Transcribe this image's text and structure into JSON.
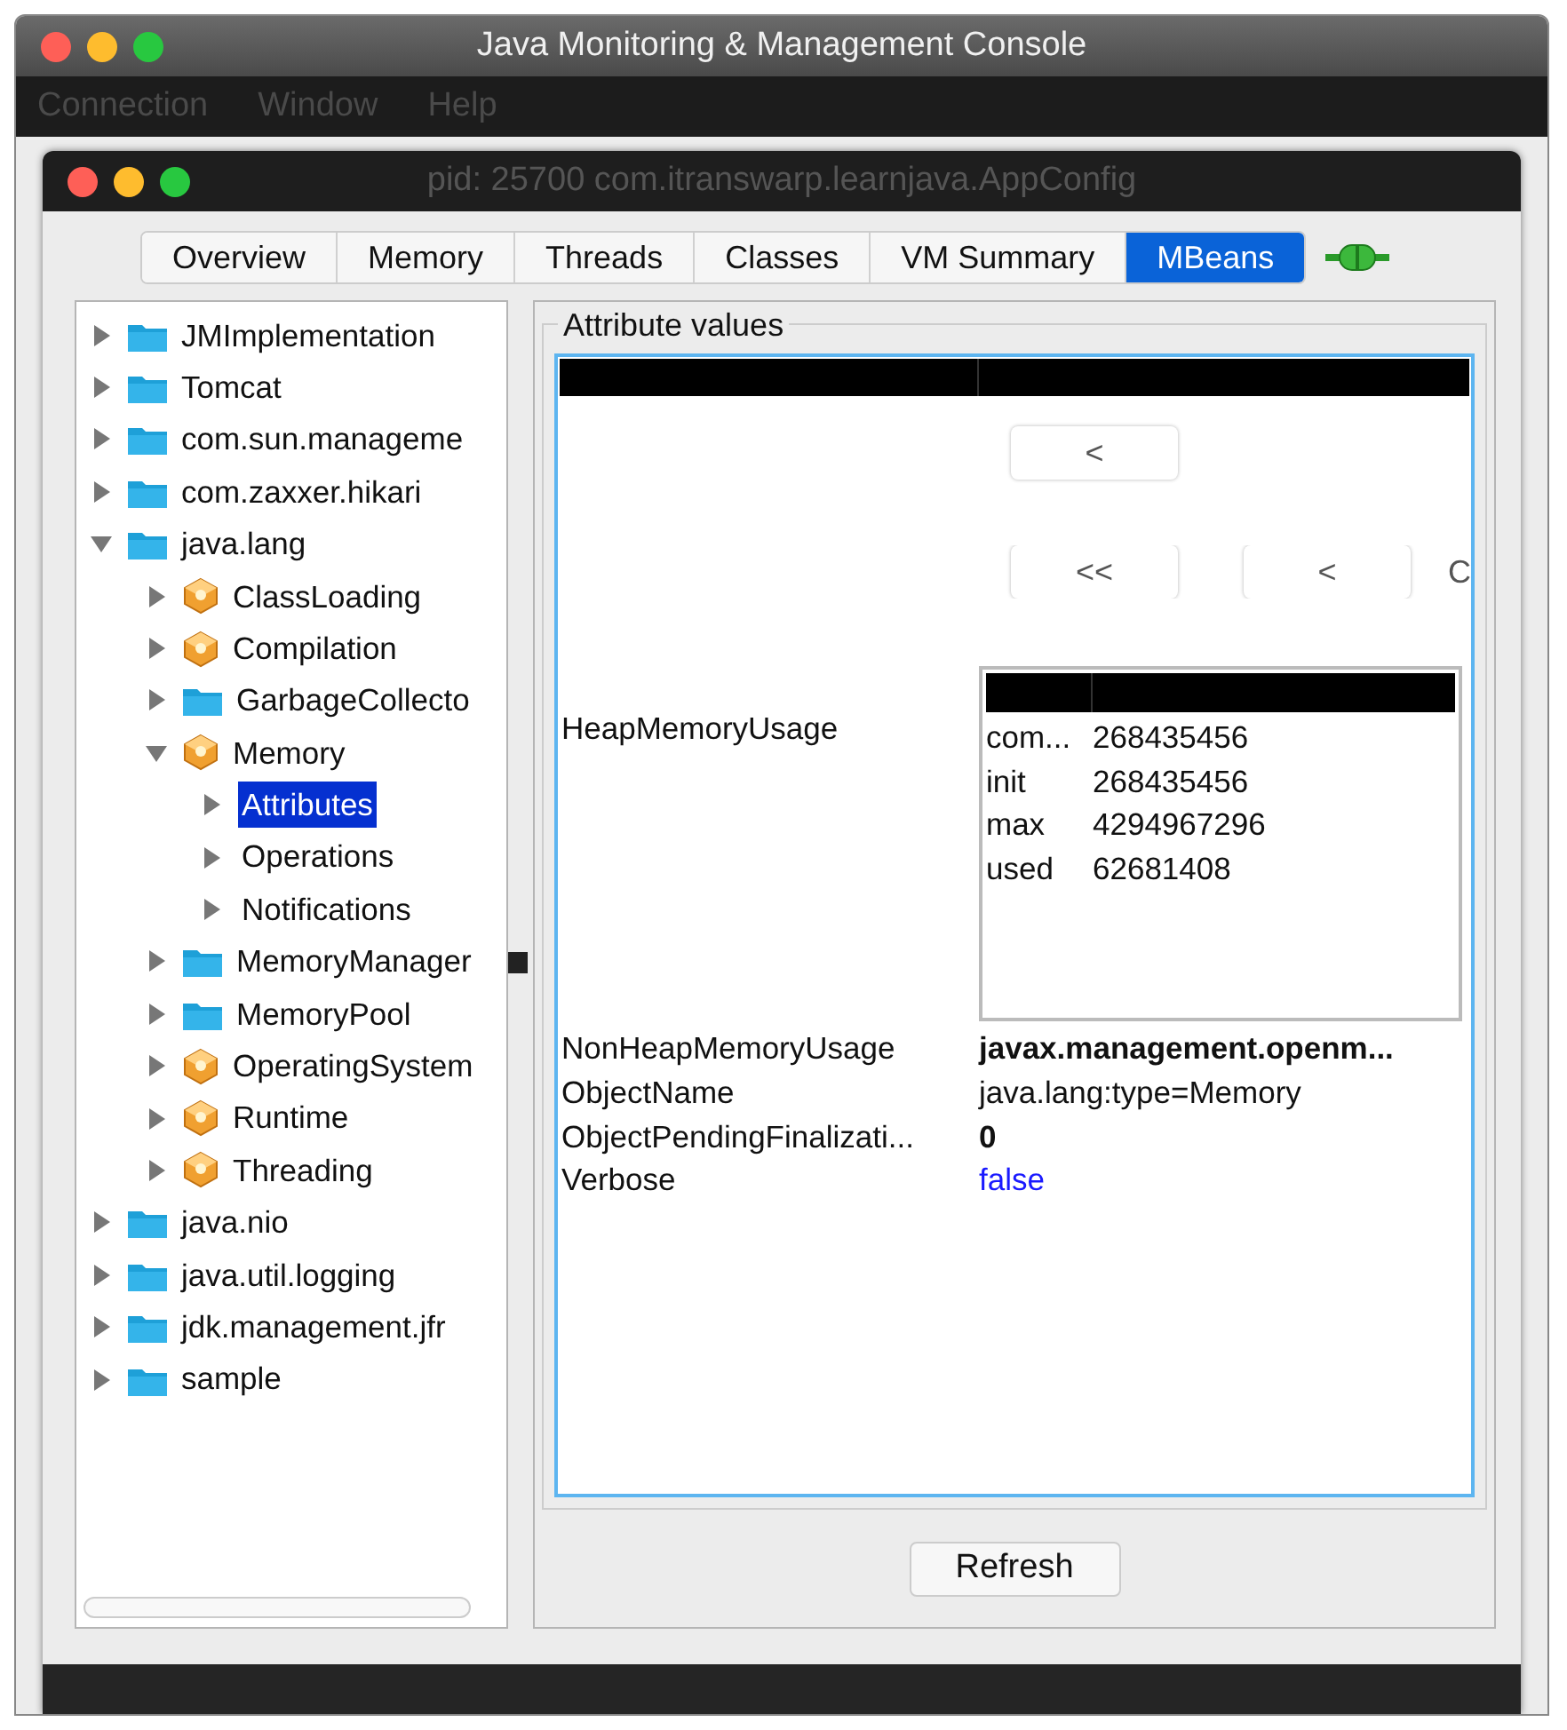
{
  "window": {
    "title": "Java Monitoring & Management Console"
  },
  "menu": [
    "Connection",
    "Window",
    "Help"
  ],
  "inner_window": {
    "title": "pid: 25700 com.itranswarp.learnjava.AppConfig"
  },
  "tabs": [
    {
      "label": "Overview",
      "selected": false
    },
    {
      "label": "Memory",
      "selected": false
    },
    {
      "label": "Threads",
      "selected": false
    },
    {
      "label": "Classes",
      "selected": false
    },
    {
      "label": "VM Summary",
      "selected": false
    },
    {
      "label": "MBeans",
      "selected": true
    }
  ],
  "tree": [
    {
      "label": "JMImplementation",
      "kind": "folder",
      "expanded": false,
      "selected": false
    },
    {
      "label": "Tomcat",
      "kind": "folder",
      "expanded": false,
      "selected": false
    },
    {
      "label": "com.sun.manageme",
      "kind": "folder",
      "expanded": false,
      "selected": false
    },
    {
      "label": "com.zaxxer.hikari",
      "kind": "folder",
      "expanded": false,
      "selected": false
    },
    {
      "label": "java.lang",
      "kind": "folder",
      "expanded": true,
      "selected": false,
      "children": [
        {
          "label": "ClassLoading",
          "kind": "bean",
          "expanded": false,
          "selected": false
        },
        {
          "label": "Compilation",
          "kind": "bean",
          "expanded": false,
          "selected": false
        },
        {
          "label": "GarbageCollecto",
          "kind": "folder",
          "expanded": false,
          "selected": false
        },
        {
          "label": "Memory",
          "kind": "bean",
          "expanded": true,
          "selected": false,
          "children": [
            {
              "label": "Attributes",
              "expanded": false,
              "selected": true
            },
            {
              "label": "Operations",
              "expanded": false,
              "selected": false
            },
            {
              "label": "Notifications",
              "expanded": false,
              "selected": false
            }
          ]
        },
        {
          "label": "MemoryManager",
          "kind": "folder",
          "expanded": false,
          "selected": false
        },
        {
          "label": "MemoryPool",
          "kind": "folder",
          "expanded": false,
          "selected": false
        },
        {
          "label": "OperatingSystem",
          "kind": "bean",
          "expanded": false,
          "selected": false
        },
        {
          "label": "Runtime",
          "kind": "bean",
          "expanded": false,
          "selected": false
        },
        {
          "label": "Threading",
          "kind": "bean",
          "expanded": false,
          "selected": false
        }
      ]
    },
    {
      "label": "java.nio",
      "kind": "folder",
      "expanded": false,
      "selected": false
    },
    {
      "label": "java.util.logging",
      "kind": "folder",
      "expanded": false,
      "selected": false
    },
    {
      "label": "jdk.management.jfr",
      "kind": "folder",
      "expanded": false,
      "selected": false
    },
    {
      "label": "sample",
      "kind": "folder",
      "expanded": false,
      "selected": false
    }
  ],
  "attributes": {
    "title": "Attribute values",
    "nav_buttons_1": [
      "<"
    ],
    "nav_buttons_2": [
      "<<",
      "<",
      "C"
    ],
    "heap": {
      "name": "HeapMemoryUsage",
      "rows": [
        {
          "key": "com...",
          "value": "268435456"
        },
        {
          "key": "init",
          "value": "268435456"
        },
        {
          "key": "max",
          "value": "4294967296"
        },
        {
          "key": "used",
          "value": "62681408"
        }
      ]
    },
    "rows": [
      {
        "name": "NonHeapMemoryUsage",
        "value": "javax.management.openm...",
        "kind": "bold"
      },
      {
        "name": "ObjectName",
        "value": "java.lang:type=Memory",
        "kind": "plain"
      },
      {
        "name": "ObjectPendingFinalizati...",
        "value": "0",
        "kind": "bold"
      },
      {
        "name": "Verbose",
        "value": "false",
        "kind": "boolean"
      }
    ]
  },
  "refresh_button": "Refresh"
}
